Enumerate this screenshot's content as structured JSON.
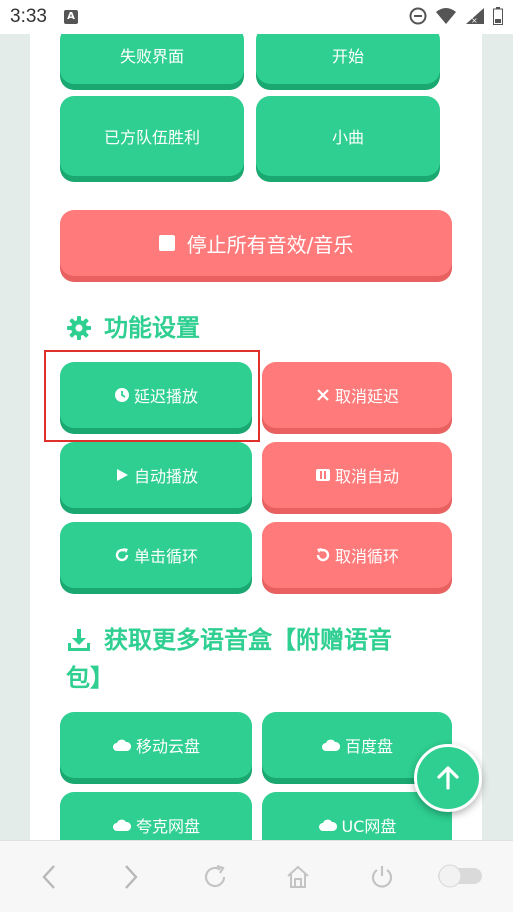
{
  "status": {
    "time": "3:33",
    "notif_letter": "A"
  },
  "top_buttons": [
    {
      "label": "失败界面"
    },
    {
      "label": "开始"
    },
    {
      "label": "已方队伍胜利"
    },
    {
      "label": "小曲"
    }
  ],
  "stop_all": {
    "label": "停止所有音效/音乐"
  },
  "settings": {
    "title": "功能设置",
    "buttons": [
      {
        "label": "延迟播放",
        "icon": "clock-icon"
      },
      {
        "label": "取消延迟",
        "icon": "close-icon"
      },
      {
        "label": "自动播放",
        "icon": "play-icon"
      },
      {
        "label": "取消自动",
        "icon": "pause-icon"
      },
      {
        "label": "单击循环",
        "icon": "redo-icon"
      },
      {
        "label": "取消循环",
        "icon": "undo-icon"
      }
    ]
  },
  "download": {
    "title_line1": "获取更多语音盒【附赠语音",
    "title_line2": "包】",
    "buttons": [
      {
        "label": "移动云盘",
        "icon": "cloud-icon"
      },
      {
        "label": "百度盘",
        "icon": "cloud-icon"
      },
      {
        "label": "夸克网盘",
        "icon": "cloud-icon"
      },
      {
        "label": "UC网盘",
        "icon": "cloud-icon"
      }
    ]
  },
  "colors": {
    "green": "#2ecf90",
    "red": "#ff7b7b"
  }
}
